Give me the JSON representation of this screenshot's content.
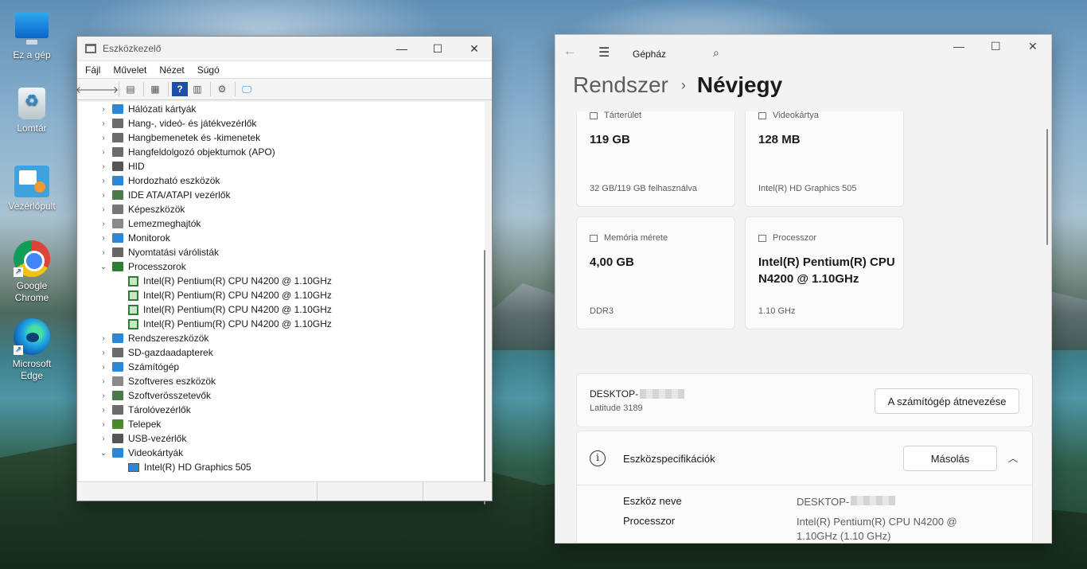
{
  "desktop": {
    "icons": [
      {
        "label": "Ez a gép",
        "icon": "computer-icon"
      },
      {
        "label": "Lomtár",
        "icon": "recycle-bin-icon"
      },
      {
        "label": "Vezérlőpult",
        "icon": "control-panel-icon"
      },
      {
        "label": "Google Chrome",
        "icon": "chrome-icon"
      },
      {
        "label": "Microsoft Edge",
        "icon": "edge-icon"
      }
    ]
  },
  "devmgr": {
    "title": "Eszközkezelő",
    "menu": [
      "Fájl",
      "Művelet",
      "Nézet",
      "Súgó"
    ],
    "toolbar": [
      "back-icon",
      "forward-icon",
      "properties-icon",
      "update-icon",
      "help-icon",
      "view-icon",
      "scan-icon",
      "monitor-icon"
    ],
    "tree": [
      {
        "label": "Hálózati kártyák",
        "expanded": false,
        "color": "#2b88d8"
      },
      {
        "label": "Hang-, videó- és játékvezérlők",
        "expanded": false,
        "color": "#6b6b6b"
      },
      {
        "label": "Hangbemenetek és -kimenetek",
        "expanded": false,
        "color": "#6b6b6b"
      },
      {
        "label": "Hangfeldolgozó objektumok (APO)",
        "expanded": false,
        "color": "#6b6b6b"
      },
      {
        "label": "HID",
        "expanded": false,
        "color": "#555555"
      },
      {
        "label": "Hordozható eszközök",
        "expanded": false,
        "color": "#2b88d8"
      },
      {
        "label": "IDE ATA/ATAPI vezérlők",
        "expanded": false,
        "color": "#4a7a4a"
      },
      {
        "label": "Képeszközök",
        "expanded": false,
        "color": "#777777"
      },
      {
        "label": "Lemezmeghajtók",
        "expanded": false,
        "color": "#8a8a8a"
      },
      {
        "label": "Monitorok",
        "expanded": false,
        "color": "#2b88d8"
      },
      {
        "label": "Nyomtatási várólisták",
        "expanded": false,
        "color": "#666666"
      },
      {
        "label": "Processzorok",
        "expanded": true,
        "color": "#2e7d32",
        "children": [
          "Intel(R) Pentium(R) CPU N4200 @ 1.10GHz",
          "Intel(R) Pentium(R) CPU N4200 @ 1.10GHz",
          "Intel(R) Pentium(R) CPU N4200 @ 1.10GHz",
          "Intel(R) Pentium(R) CPU N4200 @ 1.10GHz"
        ]
      },
      {
        "label": "Rendszereszközök",
        "expanded": false,
        "color": "#2b88d8"
      },
      {
        "label": "SD-gazdaadapterek",
        "expanded": false,
        "color": "#6b6b6b"
      },
      {
        "label": "Számítógép",
        "expanded": false,
        "color": "#2b88d8"
      },
      {
        "label": "Szoftveres eszközök",
        "expanded": false,
        "color": "#8a8a8a"
      },
      {
        "label": "Szoftverösszetevők",
        "expanded": false,
        "color": "#4a7a4a"
      },
      {
        "label": "Tárolóvezérlők",
        "expanded": false,
        "color": "#6b6b6b"
      },
      {
        "label": "Telepek",
        "expanded": false,
        "color": "#4a8a2a"
      },
      {
        "label": "USB-vezérlők",
        "expanded": false,
        "color": "#555555"
      },
      {
        "label": "Videokártyák",
        "expanded": true,
        "color": "#2b88d8",
        "children": [
          "Intel(R) HD Graphics 505"
        ]
      }
    ]
  },
  "settings": {
    "app_name": "Gépház",
    "breadcrumb_parent": "Rendszer",
    "breadcrumb_current": "Névjegy",
    "cards": [
      {
        "label": "Tárterület",
        "value": "119 GB",
        "sub": "32 GB/119 GB felhasználva"
      },
      {
        "label": "Videokártya",
        "value": "128 MB",
        "sub": "Intel(R) HD Graphics 505"
      },
      {
        "label": "Memória mérete",
        "value": "4,00 GB",
        "sub": "DDR3"
      },
      {
        "label": "Processzor",
        "value": "Intel(R) Pentium(R) CPU N4200 @ 1.10GHz",
        "sub": "1.10 GHz"
      }
    ],
    "pc_name": "DESKTOP-",
    "pc_model": "Latitude 3189",
    "rename_button": "A számítógép átnevezése",
    "specs_title": "Eszközspecifikációk",
    "copy_button": "Másolás",
    "specs": [
      {
        "key": "Eszköz neve",
        "value": "DESKTOP-"
      },
      {
        "key": "Processzor",
        "value": "Intel(R) Pentium(R) CPU N4200 @ 1.10GHz (1.10 GHz)"
      }
    ]
  }
}
